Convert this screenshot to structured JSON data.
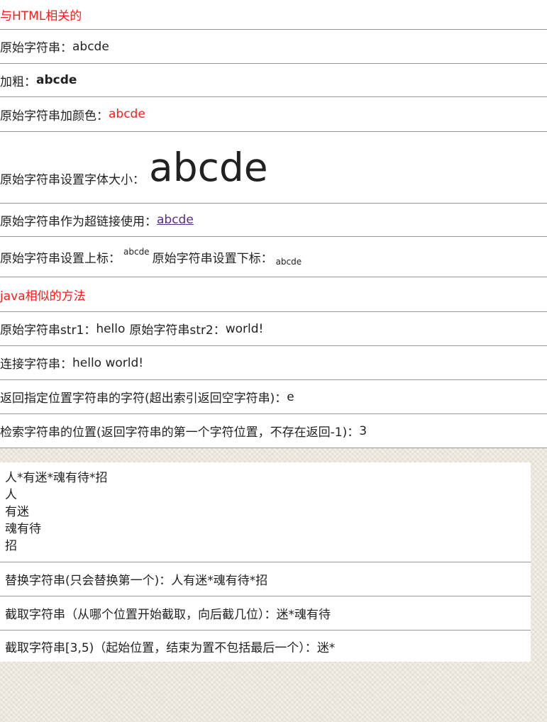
{
  "html_section": {
    "heading": "与HTML相关的",
    "original_label": "原始字符串：",
    "original_value": "abcde",
    "bold_label": "加粗：",
    "bold_value": "abcde",
    "color_label": "原始字符串加颜色：",
    "color_value": "abcde",
    "size_label": "原始字符串设置字体大小：",
    "size_value": "abcde",
    "link_label": "原始字符串作为超链接使用：",
    "link_value": "abcde",
    "sup_label": "原始字符串设置上标：",
    "sup_value": "abcde",
    "sub_label": "原始字符串设置下标：",
    "sub_value": "abcde"
  },
  "java_section": {
    "heading": "java相似的方法",
    "str1_label": "原始字符串str1：",
    "str1_value": "hello",
    "str2_label": "原始字符串str2：",
    "str2_value": "world!",
    "concat_label": "连接字符串：",
    "concat_value": "hello world!",
    "charat_label": "返回指定位置字符串的字符(超出索引返回空字符串)：",
    "charat_value": "e",
    "indexof_label": "检索字符串的位置(返回字符串的第一个字符位置，不存在返回-1)：",
    "indexof_value": "3"
  },
  "split_section": {
    "lines": [
      "人*有迷*魂有待*招",
      "人",
      "有迷",
      "魂有待",
      "招"
    ],
    "replace_label": "替换字符串(只会替换第一个)：",
    "replace_value": "人有迷*魂有待*招",
    "substr_label": "截取字符串（从哪个位置开始截取，向后截几位）：",
    "substr_value": "迷*魂有待",
    "substring_label": "截取字符串[3,5)（起始位置，结束为置不包括最后一个）：",
    "substring_value": "迷*"
  },
  "colors": {
    "accent_red": "#ff1a1a",
    "link_purple": "#5a2a8c",
    "divider": "#999999",
    "background_texture": "#ece7dc"
  }
}
